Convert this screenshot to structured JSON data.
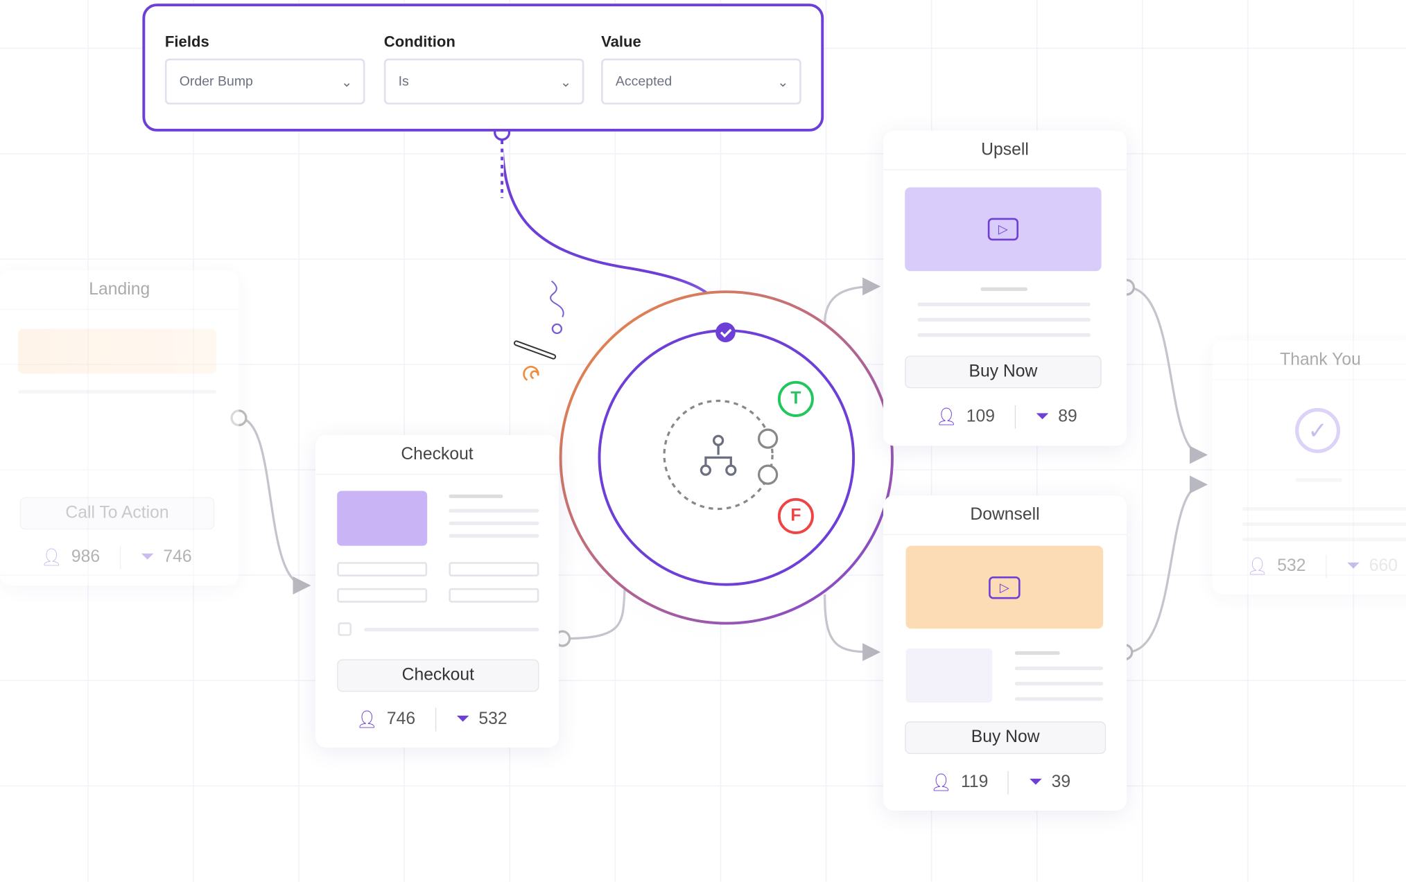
{
  "filter": {
    "fields": {
      "label": "Fields",
      "value": "Order Bump"
    },
    "condition": {
      "label": "Condition",
      "value": "Is"
    },
    "value": {
      "label": "Value",
      "value": "Accepted"
    }
  },
  "landing": {
    "title": "Landing",
    "button": "Call To Action",
    "visitors": "986",
    "conversions": "746"
  },
  "checkout": {
    "title": "Checkout",
    "button": "Checkout",
    "visitors": "746",
    "conversions": "532"
  },
  "condition_node": {
    "true_label": "T",
    "false_label": "F"
  },
  "upsell": {
    "title": "Upsell",
    "button": "Buy Now",
    "visitors": "109",
    "conversions": "89"
  },
  "downsell": {
    "title": "Downsell",
    "button": "Buy Now",
    "visitors": "119",
    "conversions": "39"
  },
  "thankyou": {
    "title": "Thank You",
    "visitors": "532",
    "conversions": "660"
  },
  "colors": {
    "accent": "#6d3fd6",
    "true": "#22c55e",
    "false": "#ef4444",
    "orange": "#f08a3c"
  }
}
